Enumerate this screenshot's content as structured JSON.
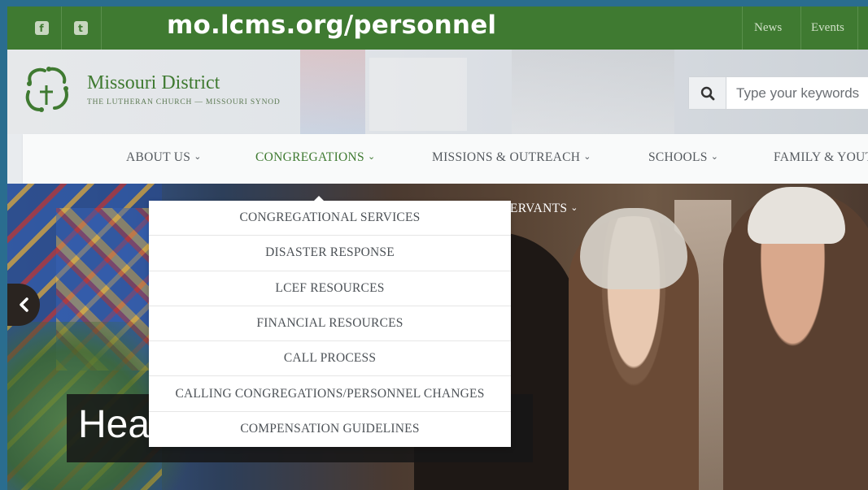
{
  "topbar": {
    "facebook_icon": "f",
    "twitter_icon": "t",
    "url": "mo.lcms.org/personnel",
    "links": [
      "News",
      "Events"
    ]
  },
  "brand": {
    "title": "Missouri District",
    "subtitle": "THE LUTHERAN CHURCH — MISSOURI SYNOD"
  },
  "search": {
    "placeholder": "Type your keywords"
  },
  "nav": {
    "items": [
      {
        "label": "ABOUT US",
        "caret": "⌄"
      },
      {
        "label": "CONGREGATIONS",
        "caret": "⌄"
      },
      {
        "label": "MISSIONS & OUTREACH",
        "caret": "⌄"
      },
      {
        "label": "SCHOOLS",
        "caret": "⌄"
      },
      {
        "label": "FAMILY & YOUT"
      }
    ],
    "second_row": {
      "label": "SERVANTS",
      "caret": "⌄"
    }
  },
  "dropdown": {
    "items": [
      "CONGREGATIONAL SERVICES",
      "DISASTER RESPONSE",
      "LCEF RESOURCES",
      "FINANCIAL RESOURCES",
      "CALL PROCESS",
      "CALLING CONGREGATIONS/PERSONNEL CHANGES",
      "COMPENSATION GUIDELINES"
    ]
  },
  "hero": {
    "caption": "Hea"
  },
  "colors": {
    "brand_green": "#3f7a31",
    "frame_blue": "#2a6d8f"
  }
}
